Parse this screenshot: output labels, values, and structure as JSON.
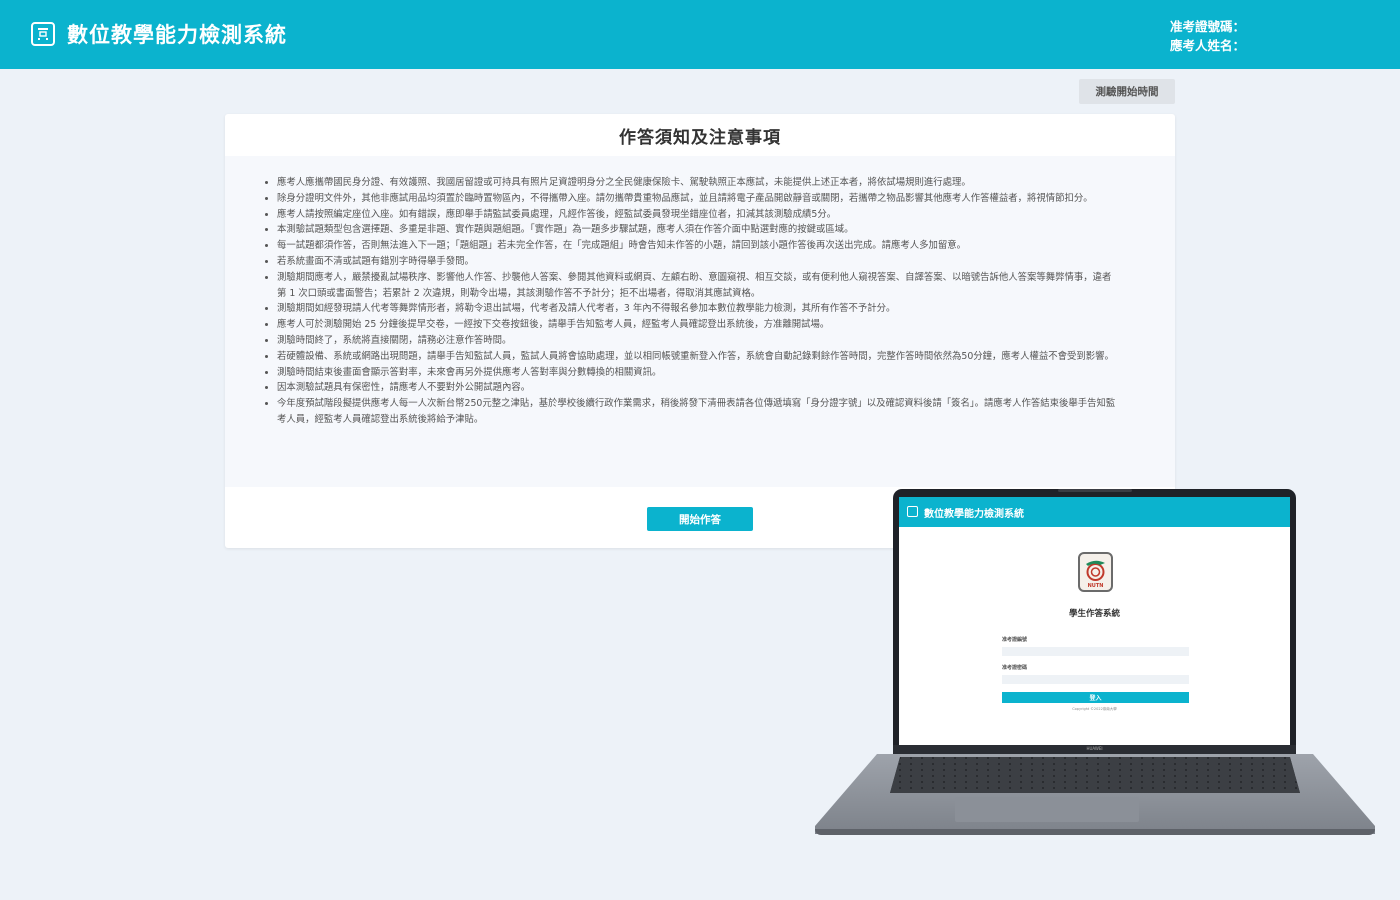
{
  "header": {
    "title": "數位教學能力檢測系統",
    "ticket_label": "准考證號碼：",
    "name_label": "應考人姓名："
  },
  "toolbar": {
    "start_time_label": "測驗開始時間"
  },
  "card": {
    "title": "作答須知及注意事項",
    "notices": [
      "應考人應攜帶國民身分證、有效護照、我國居留證或可持具有照片足資證明身分之全民健康保險卡、駕駛執照正本應試，未能提供上述正本者，將依試場規則進行處理。",
      "除身分證明文件外，其他非應試用品均須置於臨時置物區內，不得攜帶入座。請勿攜帶貴重物品應試，並且請將電子產品開啟靜音或關閉，若攜帶之物品影響其他應考人作答權益者，將視情節扣分。",
      "應考人請按照編定座位入座。如有錯誤，應即舉手請監試委員處理，凡經作答後，經監試委員發現坐錯座位者，扣減其該測驗成績5分。",
      "本測驗試題類型包含選擇題、多重是非題、實作題與題組題。「實作題」為一題多步驟試題，應考人須在作答介面中點選對應的按鍵或區域。",
      "每一試題都須作答，否則無法進入下一題；「題組題」若未完全作答，在「完成題組」時會告知未作答的小題，請回到該小題作答後再次送出完成。請應考人多加留意。",
      "若系統畫面不清或試題有錯別字時得舉手發問。",
      "測驗期間應考人，嚴禁擾亂試場秩序、影響他人作答、抄襲他人答案、參閱其他資料或網頁、左顧右盼、意圖窺視、相互交談，或有便利他人窺視答案、自譯答案、以暗號告訴他人答案等舞弊情事，違者第 1 次口頭或書面警告；若累計 2 次違規，則勒令出場，其該測驗作答不予計分；拒不出場者，得取消其應試資格。",
      "測驗期間如經發現請人代考等舞弊情形者，將勒令退出試場，代考者及請人代考者，3 年內不得報名參加本數位教學能力檢測，其所有作答不予計分。",
      "應考人可於測驗開始 25 分鐘後提早交卷，一經按下交卷按鈕後，請舉手告知監考人員，經監考人員確認登出系統後，方准離開試場。",
      "測驗時間終了，系統將直接關閉，請務必注意作答時間。",
      "若硬體設備、系統或網路出現問題，請舉手告知監試人員，監試人員將會協助處理，並以相同帳號重新登入作答，系統會自動記錄剩餘作答時間，完整作答時間依然為50分鐘，應考人權益不會受到影響。",
      "測驗時間結束後畫面會顯示答對率，未來會再另外提供應考人答對率與分數轉換的相關資訊。",
      "因本測驗試題具有保密性，請應考人不要對外公開試題內容。",
      "今年度預試階段擬提供應考人每一人次新台幣250元整之津貼，基於學校後續行政作業需求，稍後將發下清冊表請各位傳遞填寫「身分證字號」以及確認資料後請「簽名」。請應考人作答結束後舉手告知監考人員，經監考人員確認登出系統後將給予津貼。"
    ],
    "start_button_label": "開始作答"
  },
  "laptop": {
    "screen_title": "數位教學能力檢測系統",
    "emblem_text": "NUTN",
    "system_name": "學生作答系統",
    "field1_label": "准考證編號",
    "field2_label": "准考證密碼",
    "login_label": "登入",
    "copyright": "Copyright ©2022臺南大學",
    "brand": "HUAWEI"
  },
  "colors": {
    "accent": "#0bb3ce",
    "background": "#edf2f8"
  }
}
